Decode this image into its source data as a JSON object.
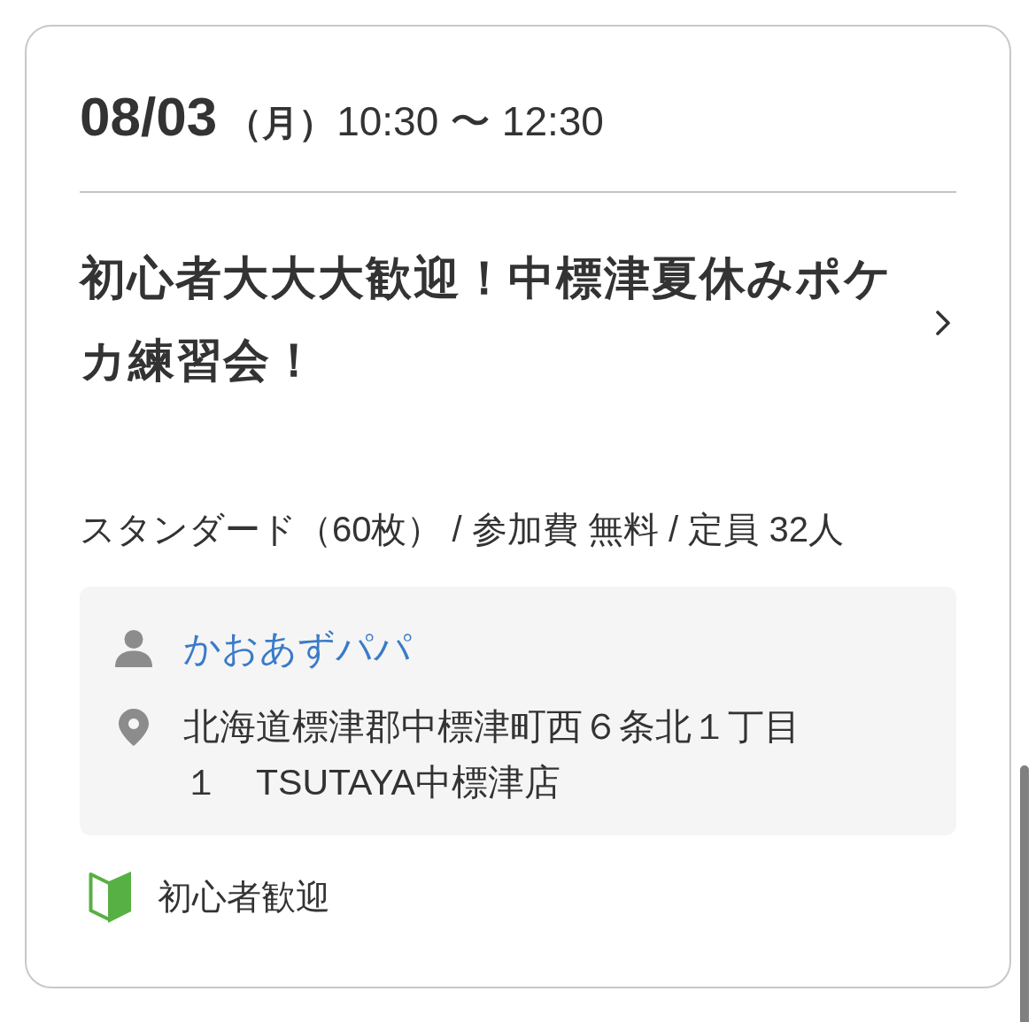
{
  "event": {
    "date": "08/03",
    "weekday": "（月）",
    "time": "10:30 〜 12:30",
    "title": "初心者大大大歓迎！中標津夏休みポケカ練習会！",
    "details": "スタンダード（60枚） / 参加費 無料 / 定員 32人",
    "organizer": "かおあずパパ",
    "address": "北海道標津郡中標津町西６条北１丁目１　TSUTAYA中標津店",
    "tags": [
      {
        "kind": "beginner",
        "label": "初心者歓迎"
      }
    ]
  }
}
